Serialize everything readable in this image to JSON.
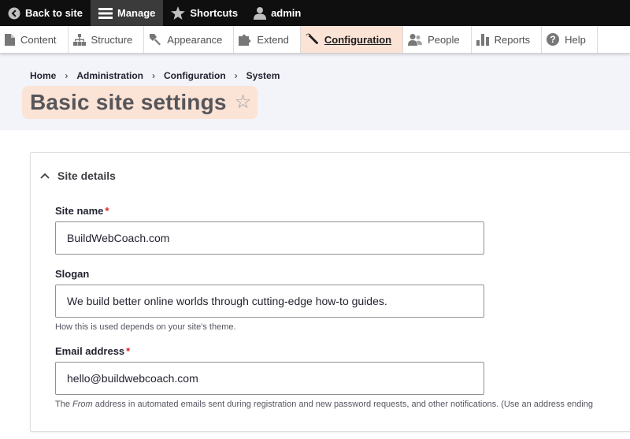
{
  "toolbar": {
    "back_label": "Back to site",
    "manage_label": "Manage",
    "shortcuts_label": "Shortcuts",
    "user_label": "admin"
  },
  "tray": {
    "items": [
      {
        "label": "Content",
        "icon": "file-icon"
      },
      {
        "label": "Structure",
        "icon": "sitemap-icon"
      },
      {
        "label": "Appearance",
        "icon": "paintbrush-icon"
      },
      {
        "label": "Extend",
        "icon": "puzzle-icon"
      },
      {
        "label": "Configuration",
        "icon": "wrench-icon",
        "active": true
      },
      {
        "label": "People",
        "icon": "people-icon"
      },
      {
        "label": "Reports",
        "icon": "bar-chart-icon"
      },
      {
        "label": "Help",
        "icon": "help-icon"
      }
    ]
  },
  "breadcrumb": {
    "items": [
      "Home",
      "Administration",
      "Configuration",
      "System"
    ],
    "separator": "›"
  },
  "page": {
    "title": "Basic site settings",
    "star": "☆"
  },
  "panel": {
    "summary": "Site details",
    "fields": {
      "site_name": {
        "label": "Site name",
        "required": "*",
        "value": "BuildWebCoach.com"
      },
      "slogan": {
        "label": "Slogan",
        "value": "We build better online worlds through cutting-edge how-to guides.",
        "description": "How this is used depends on your site's theme."
      },
      "email": {
        "label": "Email address",
        "required": "*",
        "value": "hello@buildwebcoach.com",
        "description_pre": "The ",
        "description_em": "From",
        "description_post": " address in automated emails sent during registration and new password requests, and other notifications. (Use an address ending"
      }
    }
  },
  "colors": {
    "toolbar_bg": "#0f0f0f",
    "active_tab_bg": "#fbe3d6",
    "header_bg": "#f3f4f9",
    "required": "#dc2323"
  }
}
